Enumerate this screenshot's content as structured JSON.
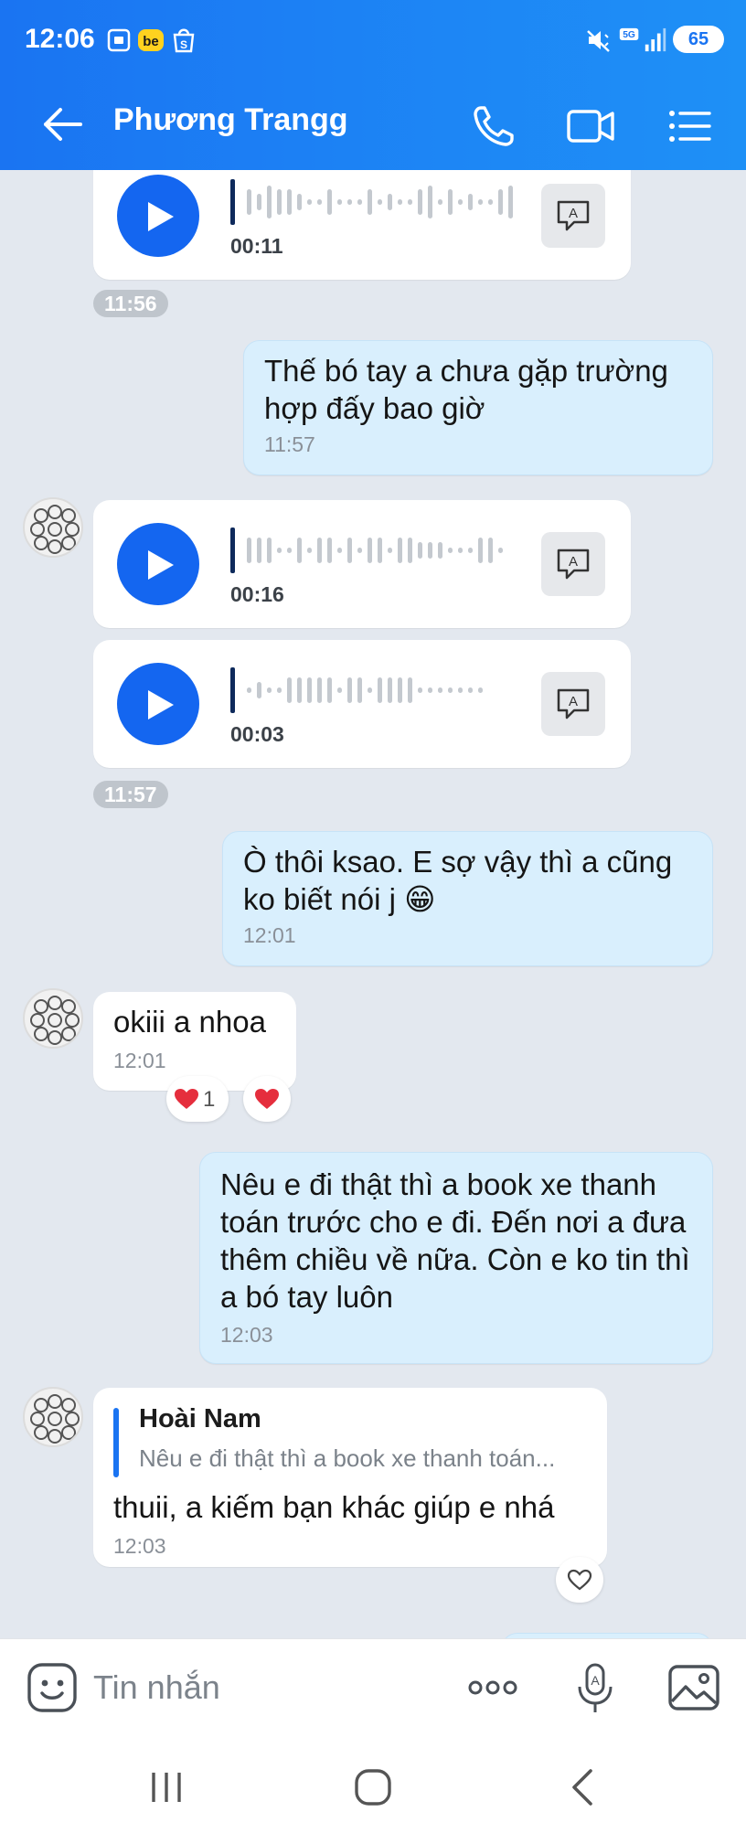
{
  "status_bar": {
    "time": "12:06",
    "battery": "65",
    "network": "5G"
  },
  "header": {
    "contact_name": "Phương Trangg",
    "icons": [
      "back-arrow-icon",
      "phone-icon",
      "video-call-icon",
      "menu-list-icon"
    ]
  },
  "messages": {
    "voice1": {
      "duration": "00:11"
    },
    "pill1": "11:56",
    "out1": {
      "text": "Thế bó tay a chưa gặp trường hợp đấy bao giờ",
      "time": "11:57"
    },
    "voice2": {
      "duration": "00:16"
    },
    "voice3": {
      "duration": "00:03"
    },
    "pill2": "11:57",
    "out2": {
      "text": "Ò thôi ksao. E sợ vậy thì a cũng ko biết nói j 😁",
      "time": "12:01"
    },
    "in1": {
      "text": "okiii a nhoa",
      "time": "12:01",
      "reaction_count": "1"
    },
    "out3": {
      "text": "Nêu e đi thật thì a book xe thanh toán trước cho e đi. Đến nơi a đưa thêm chiều về nữa. Còn e ko tin thì a bó tay luôn",
      "time": "12:03"
    },
    "in2": {
      "quote_name": "Hoài Nam",
      "quote_text": "Nêu e đi thật thì a book xe thanh toán...",
      "text": "thuii, a kiếm bạn khác giúp e nhá",
      "time": "12:03"
    }
  },
  "input": {
    "placeholder": "Tin nhắn"
  },
  "colors": {
    "header": "#1a74f2",
    "outgoing_bubble": "#d9effd",
    "incoming_bubble": "#ffffff",
    "play_button": "#1466f0",
    "background": "#e3e8ef"
  }
}
